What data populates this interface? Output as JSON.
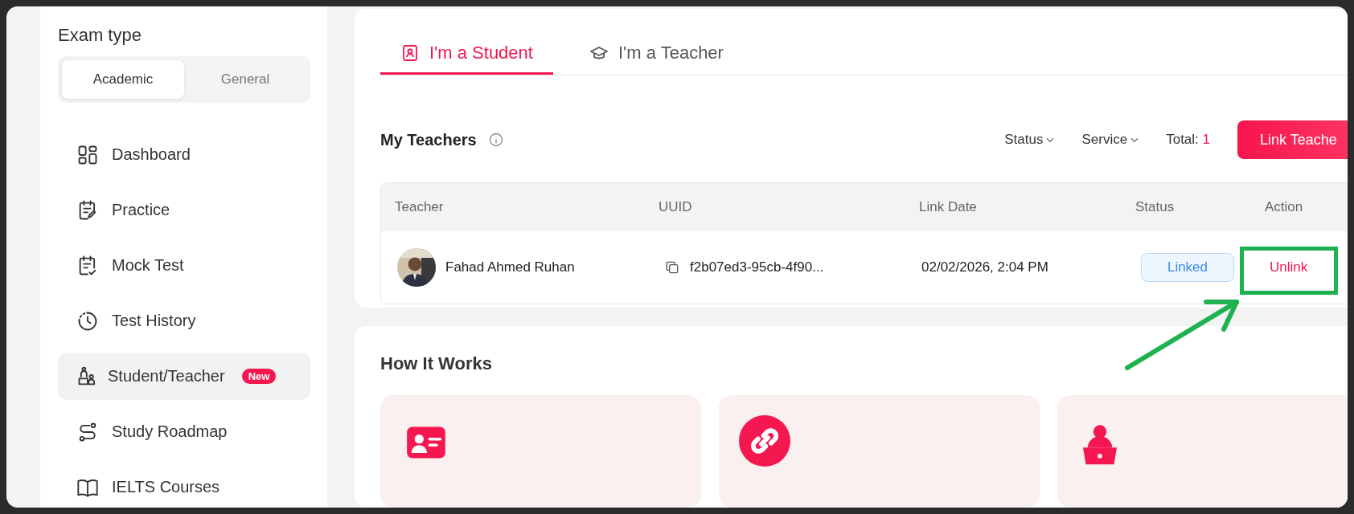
{
  "sidebar": {
    "title": "Exam type",
    "exam_types": [
      {
        "label": "Academic",
        "selected": true
      },
      {
        "label": "General",
        "selected": false
      }
    ],
    "items": [
      {
        "label": "Dashboard",
        "selected": false
      },
      {
        "label": "Practice",
        "selected": false
      },
      {
        "label": "Mock Test",
        "selected": false
      },
      {
        "label": "Test History",
        "selected": false
      },
      {
        "label": "Student/Teacher",
        "selected": true,
        "badge": "New"
      },
      {
        "label": "Study Roadmap",
        "selected": false
      },
      {
        "label": "IELTS Courses",
        "selected": false
      }
    ]
  },
  "tabs": [
    {
      "label": "I'm a Student",
      "selected": true
    },
    {
      "label": "I'm a Teacher",
      "selected": false
    }
  ],
  "teachers": {
    "title": "My Teachers",
    "filters": [
      "Status",
      "Service"
    ],
    "total_label": "Total:",
    "total": "1",
    "button": "Link Teache",
    "columns": [
      "Teacher",
      "UUID",
      "Link Date",
      "Status",
      "Action"
    ],
    "rows": [
      {
        "teacher": "Fahad Ahmed Ruhan",
        "uuid": "f2b07ed3-95cb-4f90...",
        "link_date": "02/02/2026, 2:04 PM",
        "status": "Linked",
        "action": "Unlink"
      }
    ]
  },
  "how_it_works": {
    "title": "How It Works"
  }
}
